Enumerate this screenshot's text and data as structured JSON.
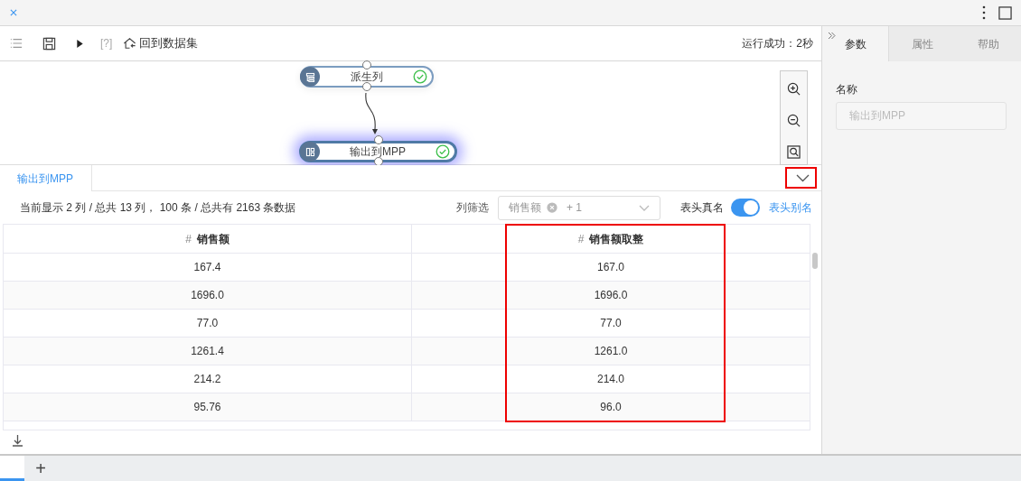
{
  "toolbar": {
    "help_label": "[?]",
    "back_label": "回到数据集",
    "status": "运行成功：2秒"
  },
  "canvas": {
    "nodes": [
      {
        "label": "派生列",
        "kind": "derive",
        "selected": false,
        "success": true
      },
      {
        "label": "输出到MPP",
        "kind": "output",
        "selected": true,
        "success": true
      }
    ]
  },
  "result": {
    "tabs": [
      {
        "label": "输出到MPP",
        "selected": true
      }
    ],
    "summary": "当前显示 2 列 / 总共 13 列， 100 条 / 总共有 2163 条数据",
    "filter": {
      "label": "列筛选",
      "tag": "销售额",
      "more": "+ 1"
    },
    "toggle": {
      "label": "表头真名",
      "on": true,
      "alt_label": "表头别名"
    },
    "table": {
      "columns": [
        {
          "type": "#",
          "name": "销售额"
        },
        {
          "type": "#",
          "name": "销售额取整"
        }
      ],
      "rows": [
        [
          "167.4",
          "167.0"
        ],
        [
          "1696.0",
          "1696.0"
        ],
        [
          "77.0",
          "77.0"
        ],
        [
          "1261.4",
          "1261.0"
        ],
        [
          "214.2",
          "214.0"
        ],
        [
          "95.76",
          "96.0"
        ]
      ]
    }
  },
  "side_panel": {
    "tabs": [
      {
        "label": "参数",
        "selected": true
      },
      {
        "label": "属性",
        "selected": false
      },
      {
        "label": "帮助",
        "selected": false
      }
    ],
    "field_label": "名称",
    "field_value": "输出到MPP",
    "field_disabled": true
  },
  "bottom_tabs": {
    "add_label": "+"
  }
}
